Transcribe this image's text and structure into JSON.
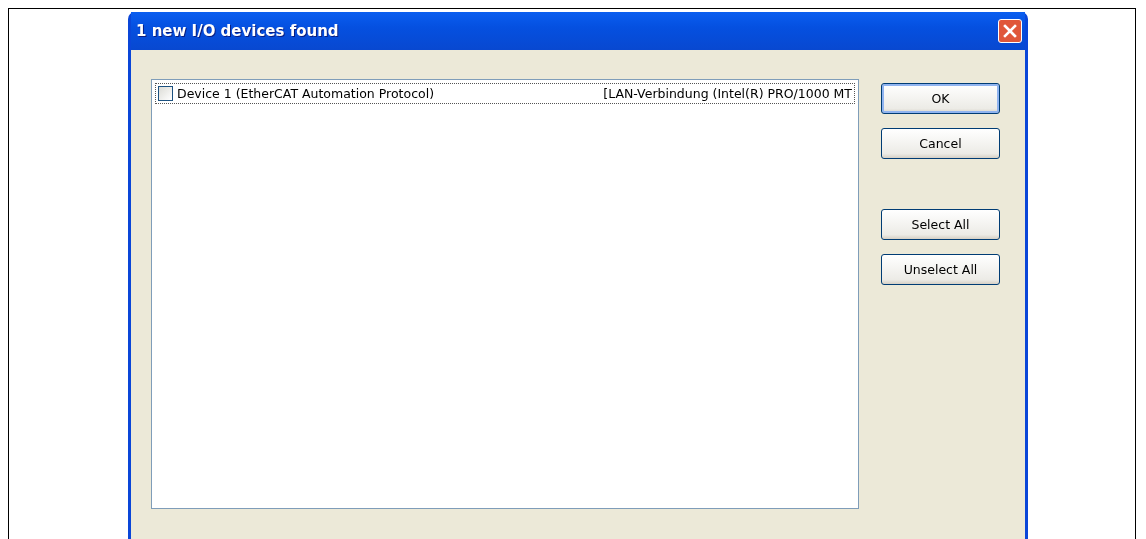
{
  "window": {
    "title": "1 new I/O devices found"
  },
  "devices": [
    {
      "name": "Device 1 (EtherCAT Automation Protocol)",
      "adapter": "[LAN-Verbindung (Intel(R) PRO/1000 MT",
      "checked": false,
      "selected": true
    }
  ],
  "buttons": [
    {
      "label": "OK",
      "kind": "default"
    },
    {
      "label": "Cancel",
      "kind": "normal"
    },
    {
      "label": "Select All",
      "kind": "spaced"
    },
    {
      "label": "Unselect All",
      "kind": "normal"
    }
  ]
}
